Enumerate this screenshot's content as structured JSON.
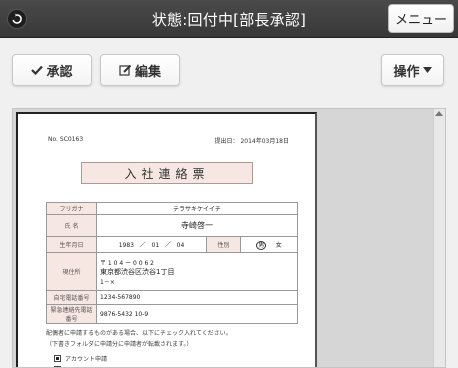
{
  "header": {
    "back_icon": "back-arrow-icon",
    "title": "状態:回付中[部長承認]",
    "menu_label": "メニュー"
  },
  "toolbar": {
    "approve_icon": "checkmark-icon",
    "approve_label": "承認",
    "edit_icon": "pencil-icon",
    "edit_label": "編集",
    "ops_label": "操作",
    "ops_icon": "caret-down-icon"
  },
  "document": {
    "doc_no": "No. SC0163",
    "date": "提出日： 2014年03月18日",
    "title": "入社連絡票",
    "rows": {
      "furigana_label": "フリガナ",
      "furigana_value": "テラサキケイイチ",
      "name_label": "氏 名",
      "name_value": "寺崎啓一",
      "birth_label": "生年月日",
      "birth_year": "1983",
      "birth_month": "01",
      "birth_day": "04",
      "gender_label": "性別",
      "gender_male": "男",
      "gender_female": "女",
      "address_label": "現住所",
      "postal": "〒 1 0 4 ー 0 0 6 2",
      "address_value": "東京都渋谷区渋谷1丁目",
      "address_kana": "1－×",
      "phone_label": "自宅電話番号",
      "phone_value": "1234-567890",
      "emergency_label": "緊急連絡先電話番号",
      "emergency_value": "9876-5432 10-9"
    },
    "note_line1": "配偶者に申請するものがある場合、以下にチェック入れてください。",
    "note_line2": "（下書きフォルダに申請分に申請者が転載されます。）",
    "check1_label": "アカウント申請",
    "check1_checked": true,
    "check2_label": ""
  }
}
